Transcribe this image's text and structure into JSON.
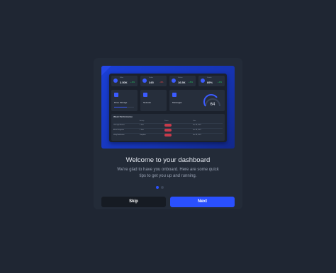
{
  "colors": {
    "accent": "#2a50ff",
    "positive": "#22c55e",
    "negative": "#ef4444"
  },
  "modal": {
    "title": "Welcome to your dashboard",
    "body": "We're glad to have you onboard. Here are some quick tips to get you up and running.",
    "step": 1,
    "total_steps": 2,
    "skip_label": "Skip",
    "next_label": "Next"
  },
  "preview": {
    "stats": [
      {
        "label": "Sales",
        "value": "2.50K",
        "pct": "+3%",
        "icon": "chart-icon"
      },
      {
        "label": "Orders",
        "value": "245",
        "pct": "-4%",
        "icon": "cart-icon"
      },
      {
        "label": "Visitors",
        "value": "16.5K",
        "pct": "+6%",
        "icon": "users-icon"
      },
      {
        "label": "Growth",
        "value": "89%",
        "pct": "+3%",
        "icon": "trend-icon"
      }
    ],
    "cards": [
      {
        "title": "Drive Storage",
        "icon": "drive-icon",
        "progress": 0.65
      },
      {
        "title": "Network",
        "icon": "network-icon"
      },
      {
        "title": "Messages",
        "icon": "message-icon"
      }
    ],
    "gauge_value": "64",
    "table": {
      "title": "Week Performance",
      "columns": [
        "",
        "Activity",
        "Status",
        "Date"
      ],
      "rows": [
        {
          "name": "Oversight Review",
          "activity": "1 Task",
          "date": "Jun 18, 2021"
        },
        {
          "name": "Alexa Integration",
          "activity": "1 Task",
          "date": "Jun 18, 2021"
        },
        {
          "name": "Verify Notification",
          "activity": "Complete",
          "date": "Jun 18, 2021"
        }
      ]
    }
  }
}
